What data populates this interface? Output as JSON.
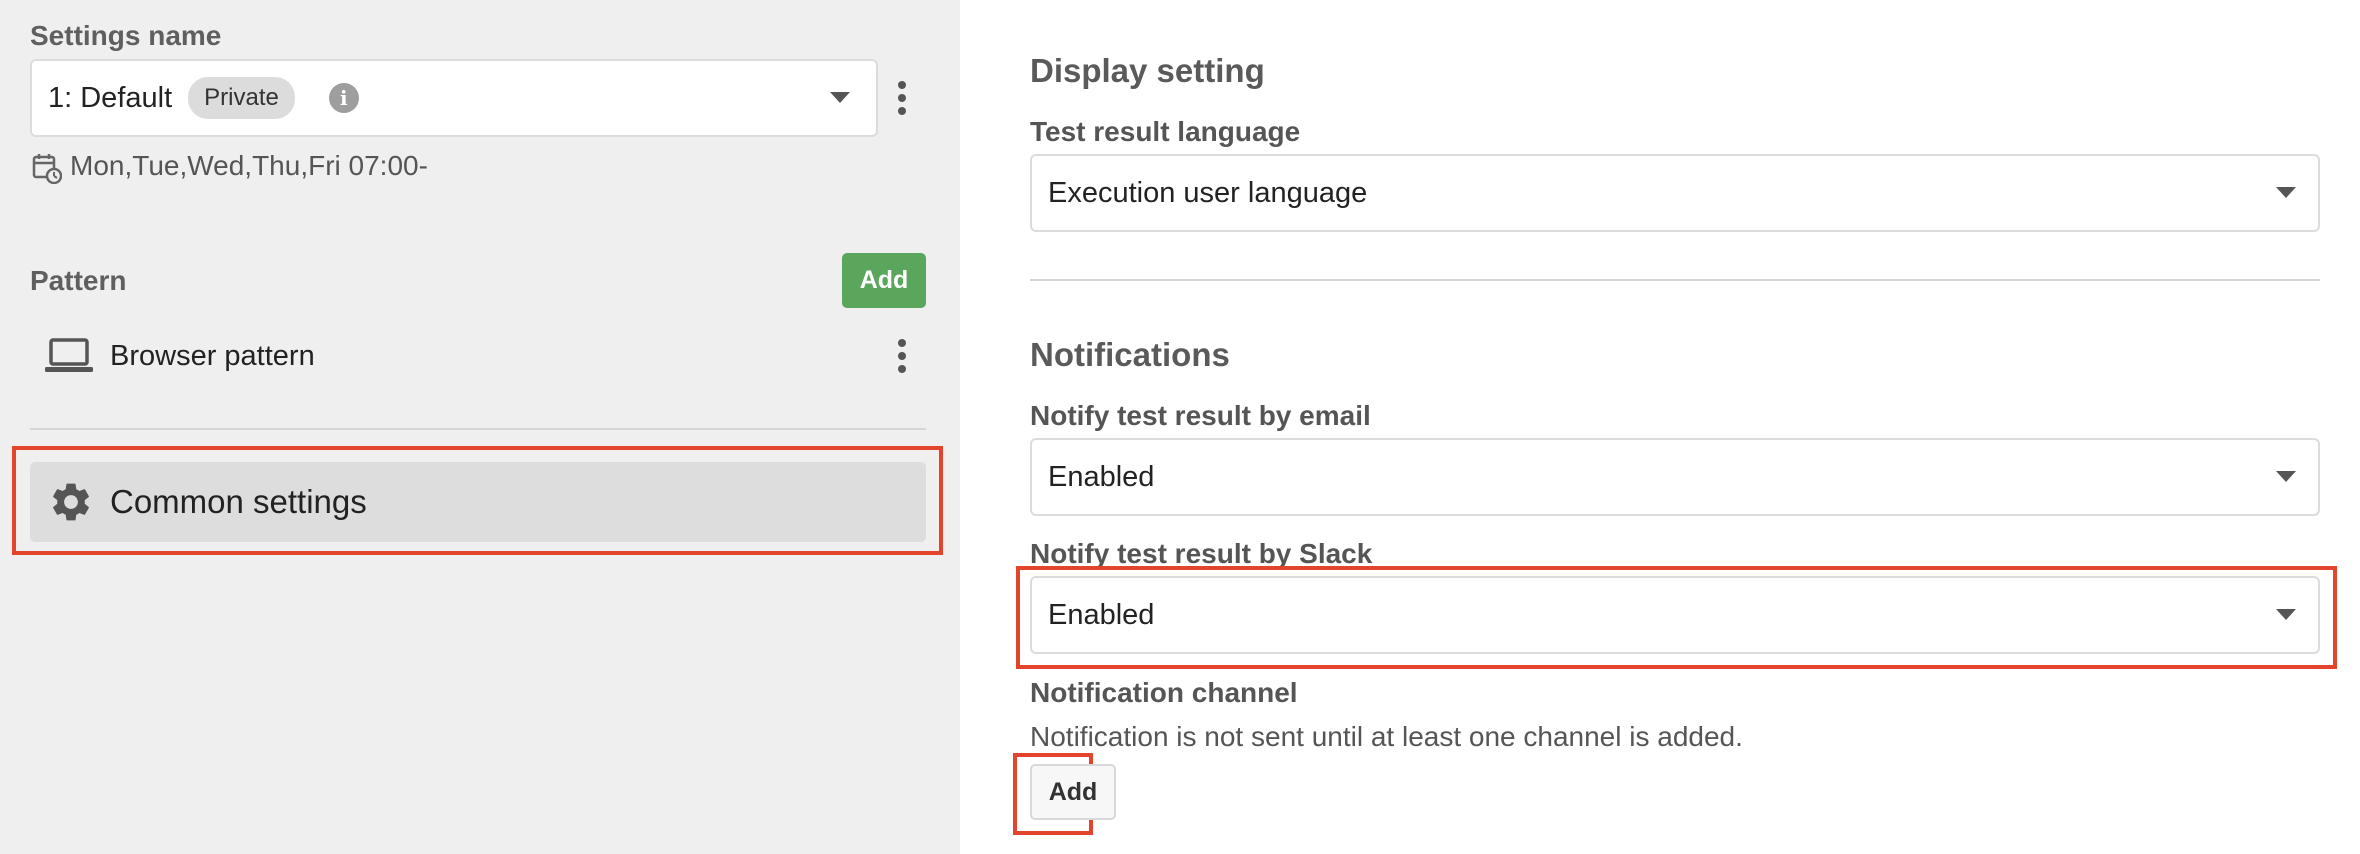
{
  "left": {
    "settings_name_label": "Settings name",
    "settings_select": {
      "value": "1: Default",
      "badge": "Private",
      "info_icon": "i"
    },
    "schedule_text": "Mon,Tue,Wed,Thu,Fri 07:00-",
    "pattern_label": "Pattern",
    "add_button_label": "Add",
    "pattern_items": [
      {
        "label": "Browser pattern",
        "icon": "laptop-icon"
      }
    ],
    "common_settings_label": "Common settings",
    "common_settings_icon": "gear-icon"
  },
  "right": {
    "display_title": "Display setting",
    "test_result_language_label": "Test result language",
    "test_result_language_value": "Execution user language",
    "notifications_title": "Notifications",
    "email_label": "Notify test result by email",
    "email_value": "Enabled",
    "slack_label": "Notify test result by Slack",
    "slack_value": "Enabled",
    "channel_label": "Notification channel",
    "channel_help": "Notification is not sent until at least one channel is added.",
    "channel_add_label": "Add"
  },
  "colors": {
    "highlight": "#e2452c",
    "green": "#5aa65d",
    "left_background": "#efefef"
  }
}
